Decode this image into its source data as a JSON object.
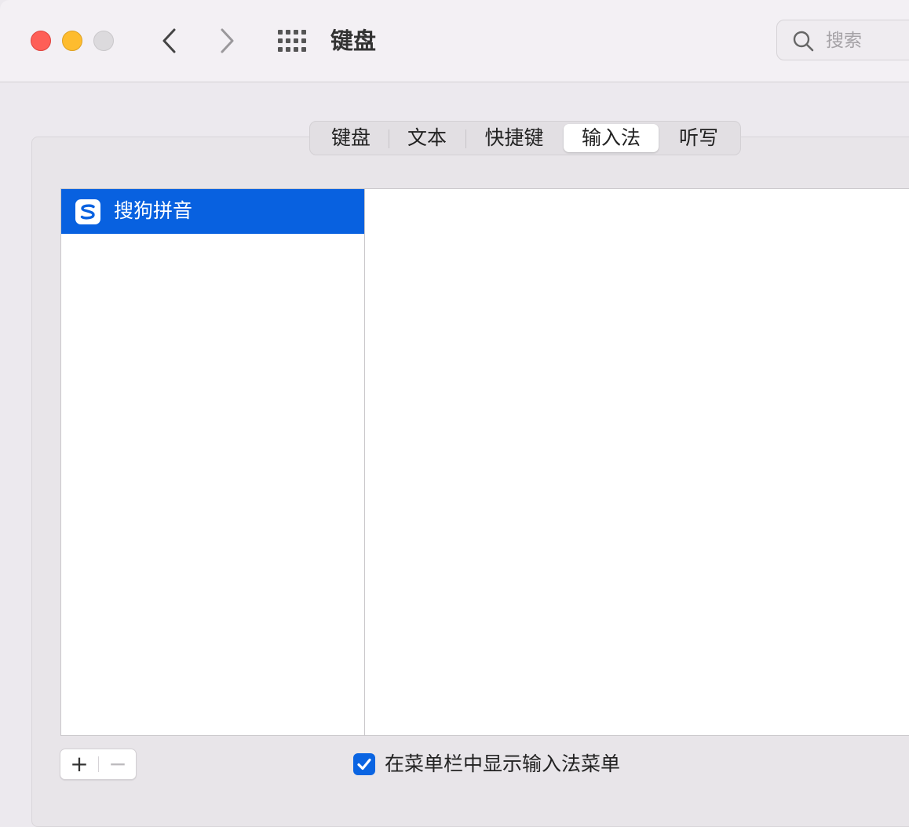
{
  "window": {
    "title": "键盘"
  },
  "search": {
    "placeholder": "搜索"
  },
  "tabs": [
    {
      "label": "键盘",
      "active": false
    },
    {
      "label": "文本",
      "active": false
    },
    {
      "label": "快捷键",
      "active": false
    },
    {
      "label": "输入法",
      "active": true
    },
    {
      "label": "听写",
      "active": false
    }
  ],
  "input_sources": [
    {
      "label": "搜狗拼音",
      "icon": "sogou-logo-icon",
      "selected": true
    }
  ],
  "buttons": {
    "add": "+",
    "remove": "−"
  },
  "show_menu_checkbox": {
    "label": "在菜单栏中显示输入法菜单",
    "checked": true
  },
  "colors": {
    "selection": "#0861e0",
    "checkbox": "#0a64e2"
  }
}
